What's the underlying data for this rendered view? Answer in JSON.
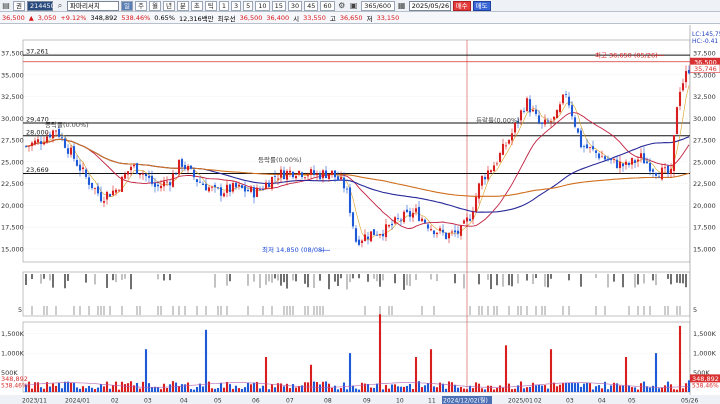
{
  "toolbar": {
    "period_button": "권",
    "code": "214450",
    "name": "파마리서치",
    "intervals": [
      "일",
      "주",
      "월",
      "년",
      "분",
      "초",
      "틱"
    ],
    "minute_values": [
      "1",
      "3",
      "5",
      "10",
      "15",
      "30",
      "45",
      "60"
    ],
    "bars_count": "365/600",
    "date": "2025/05/26",
    "buy_label": "매수",
    "sell_label": "매도"
  },
  "quote": {
    "price": "36,500",
    "change": "3,050",
    "change_pct": "+9.12%",
    "volume": "348,892",
    "volume_ratio": "538.46%",
    "turnover": "0.65%",
    "amount": "12,316백만",
    "best_bid_label": "최우선",
    "best_bid": "36,500",
    "best_ask": "36,400",
    "open_label": "시",
    "open": "33,550",
    "high_label": "고",
    "high": "36,650",
    "low_label": "저",
    "low": "33,150"
  },
  "chart_data": {
    "type": "candlestick",
    "price_axis": {
      "ticks": [
        "37,500",
        "35,000",
        "32,500",
        "30,000",
        "27,500",
        "25,000",
        "22,500",
        "20,000",
        "17,500",
        "15,000"
      ],
      "ylim": [
        13500,
        39000
      ]
    },
    "right_labels": {
      "lc": "LC:145,75",
      "hc": "HC:-0.41",
      "current": "36,500",
      "reference": "35,746"
    },
    "horizontal_levels": [
      {
        "label": "37,261",
        "value": 37261
      },
      {
        "label": "29,470",
        "value": 29470
      },
      {
        "label": "28,000",
        "value": 28000
      },
      {
        "label": "23,669",
        "value": 23669
      }
    ],
    "annotations": [
      {
        "text": "최고 36,650 (05/26)",
        "value": 36650
      },
      {
        "text": "최저 14,850 (08/08)",
        "value": 14850
      },
      {
        "text": "등락률(0.00%)",
        "value": 29000
      },
      {
        "text": "등락률(0.00%)",
        "value": 25000
      },
      {
        "text": "등락률(0.00%)",
        "value": 29500
      }
    ],
    "volume_axis": {
      "ticks": [
        "1,500K",
        "1,000K",
        "500K"
      ],
      "current": "348,892",
      "ratio": "538.46%"
    },
    "indicator_axis": {
      "ticks": [
        "5"
      ]
    },
    "x_labels": [
      "2023/11",
      "2024/01",
      "02",
      "03",
      "04",
      "05",
      "06",
      "07",
      "08",
      "09",
      "10",
      "11",
      "2024/12/02(월)",
      "2025/01",
      "02",
      "03",
      "04",
      "05",
      "05/26"
    ],
    "cursor_label": "2024/12/02(월)"
  }
}
